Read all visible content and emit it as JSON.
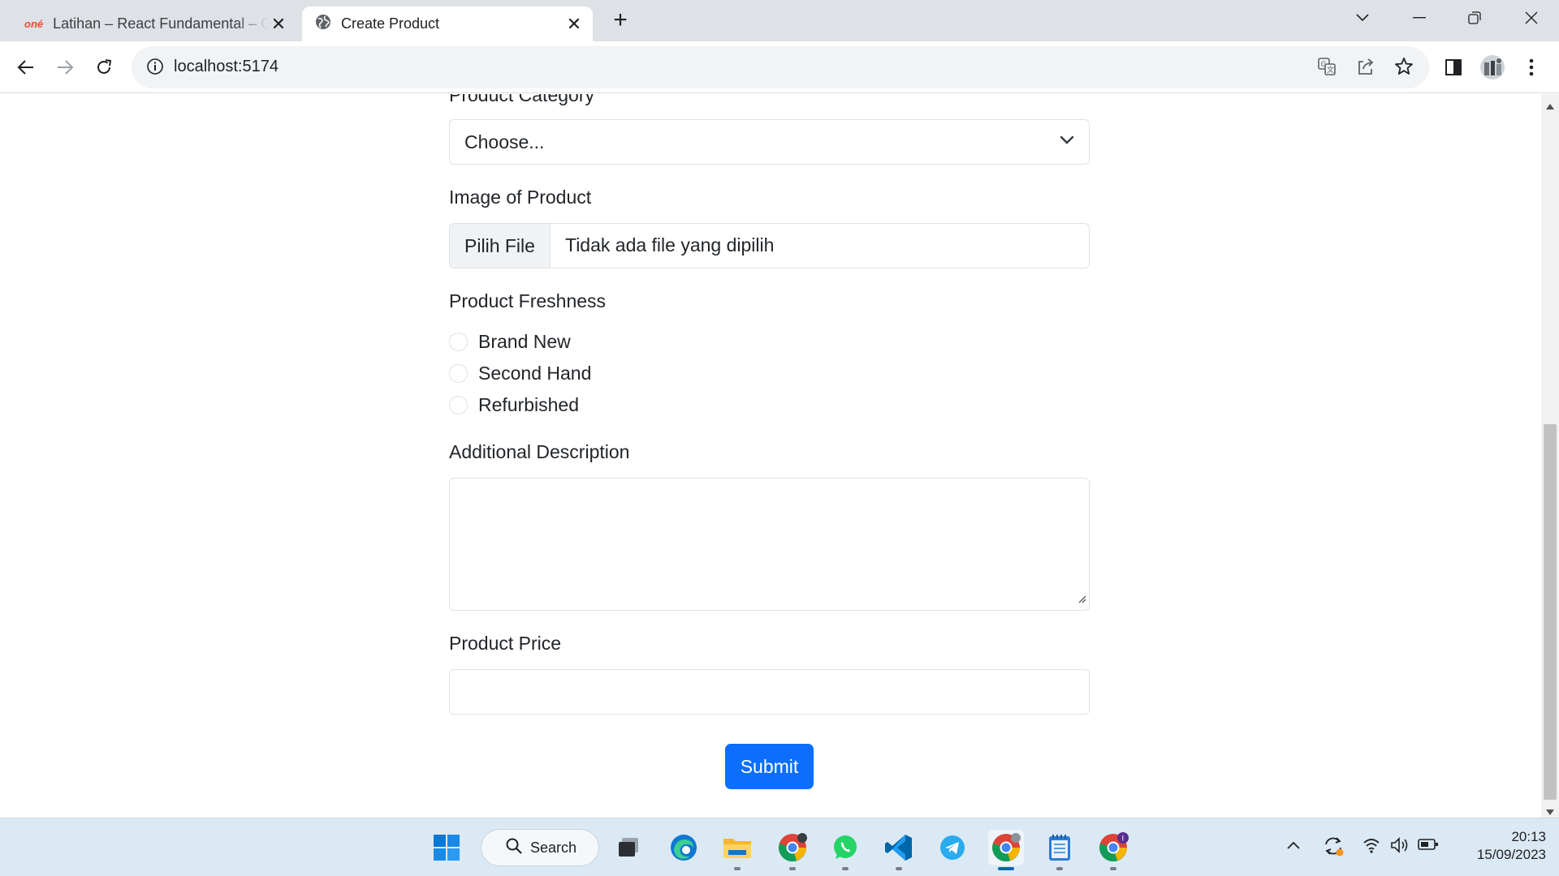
{
  "browser": {
    "tabs": [
      {
        "label": "Latihan – React Fundamental – O",
        "favicon_text": "oné",
        "active": false
      },
      {
        "label": "Create Product",
        "active": true
      }
    ],
    "url": "localhost:5174"
  },
  "form": {
    "category_label": "Product Category",
    "category_selected": "Choose...",
    "image_label": "Image of Product",
    "file_button": "Pilih File",
    "file_status": "Tidak ada file yang dipilih",
    "freshness_label": "Product Freshness",
    "freshness_options": [
      "Brand New",
      "Second Hand",
      "Refurbished"
    ],
    "description_label": "Additional Description",
    "description_value": "",
    "price_label": "Product Price",
    "price_value": "",
    "submit_label": "Submit"
  },
  "colors": {
    "primary": "#0d6efd",
    "tab_strip": "#dee1e6",
    "taskbar": "#dbe9f4"
  },
  "taskbar": {
    "search_label": "Search",
    "time": "20:13",
    "date": "15/09/2023",
    "apps": [
      "windows-start",
      "task-view",
      "edge",
      "file-explorer",
      "chrome-profile-1",
      "whatsapp",
      "vscode",
      "telegram",
      "chrome-profile-2",
      "notepad",
      "chrome-profile-3"
    ]
  }
}
